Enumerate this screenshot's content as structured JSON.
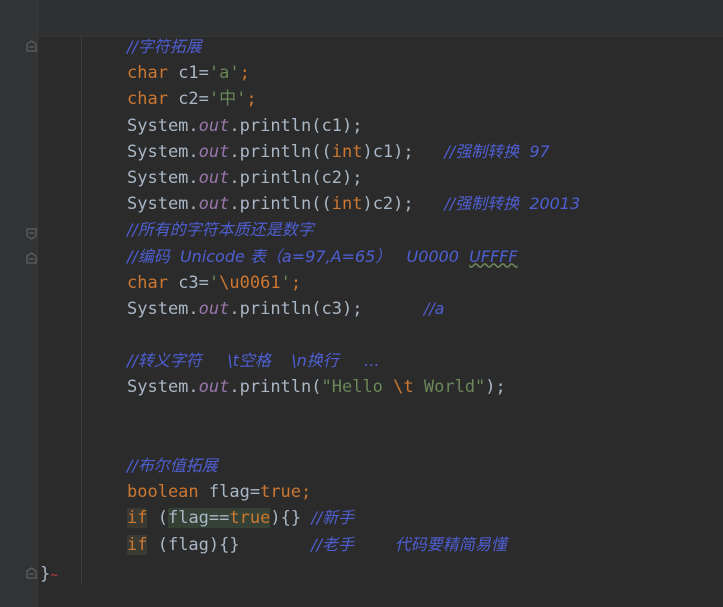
{
  "code": {
    "comment_char_ext": "//字符拓展",
    "c1_decl": {
      "type": "char",
      "name": " c1=",
      "value": "'a'",
      "end": ";"
    },
    "c2_decl": {
      "type": "char",
      "name": " c2=",
      "value": "'中'",
      "end": ";"
    },
    "print_c1": {
      "sys": "System.",
      "out": "out",
      "call": ".println(c1);"
    },
    "print_int_c1": {
      "sys": "System.",
      "out": "out",
      "pre": ".println((",
      "kw": "int",
      "post": ")c1);",
      "comment": "//强制转换  97"
    },
    "print_c2": {
      "sys": "System.",
      "out": "out",
      "call": ".println(c2);"
    },
    "print_int_c2": {
      "sys": "System.",
      "out": "out",
      "pre": ".println((",
      "kw": "int",
      "post": ")c2);",
      "comment": "//强制转换  20013"
    },
    "comment_essence": "//所有的字符本质还是数字",
    "comment_unicode": "//编码  Unicode 表（a=97,A=65）   U0000  ",
    "comment_unicode_tail": "UFFFF",
    "c3_decl": {
      "type": "char",
      "name": " c3=",
      "value_open": "'",
      "value_esc": "\\u0061",
      "value_close": "'",
      "end": ";"
    },
    "print_c3": {
      "sys": "System.",
      "out": "out",
      "call": ".println(c3);",
      "comment": "//a"
    },
    "comment_escape": "//转义字符     \\t空格    \\n换行     ...",
    "print_hello": {
      "sys": "System.",
      "out": "out",
      "pre": ".println(",
      "str1": "\"Hello ",
      "esc": "\\t",
      "str2": " World\"",
      "post": ");"
    },
    "comment_bool": "//布尔值拓展",
    "bool_decl": {
      "type": "boolean",
      "name": " flag=",
      "value": "true",
      "end": ";"
    },
    "if1": {
      "kw": "if",
      "pre": " (",
      "cond": "flag==",
      "val": "true",
      "post": "){}",
      "comment": "//新手"
    },
    "if2": {
      "kw": "if",
      "rest": " (flag){}",
      "comment": "//老手        代码要精简易懂"
    },
    "closing_brace": "}"
  }
}
